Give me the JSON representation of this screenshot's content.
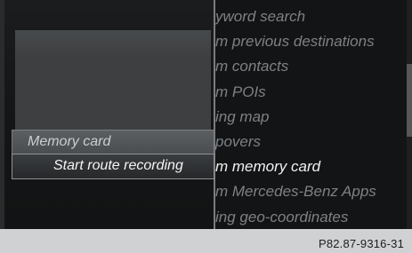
{
  "submenu": {
    "title": "Memory card",
    "items": [
      {
        "label": "Start route recording",
        "selected": true
      }
    ]
  },
  "menu": {
    "items": [
      {
        "label": "yword search",
        "active": false
      },
      {
        "label": "m previous destinations",
        "active": false
      },
      {
        "label": "m contacts",
        "active": false
      },
      {
        "label": "m POIs",
        "active": false
      },
      {
        "label": "ing map",
        "active": false
      },
      {
        "label": "povers",
        "active": false
      },
      {
        "label": "m memory card",
        "active": true
      },
      {
        "label": "m Mercedes-Benz Apps",
        "active": false
      },
      {
        "label": "ing geo-coordinates",
        "active": false
      }
    ]
  },
  "footer": {
    "code": "P82.87-9316-31"
  },
  "colors": {
    "screen_bg": "#141516",
    "caption_bg": "#cfd1d3",
    "menu_text_inactive": "#7e8184",
    "menu_text_active": "#f2f2f2"
  }
}
